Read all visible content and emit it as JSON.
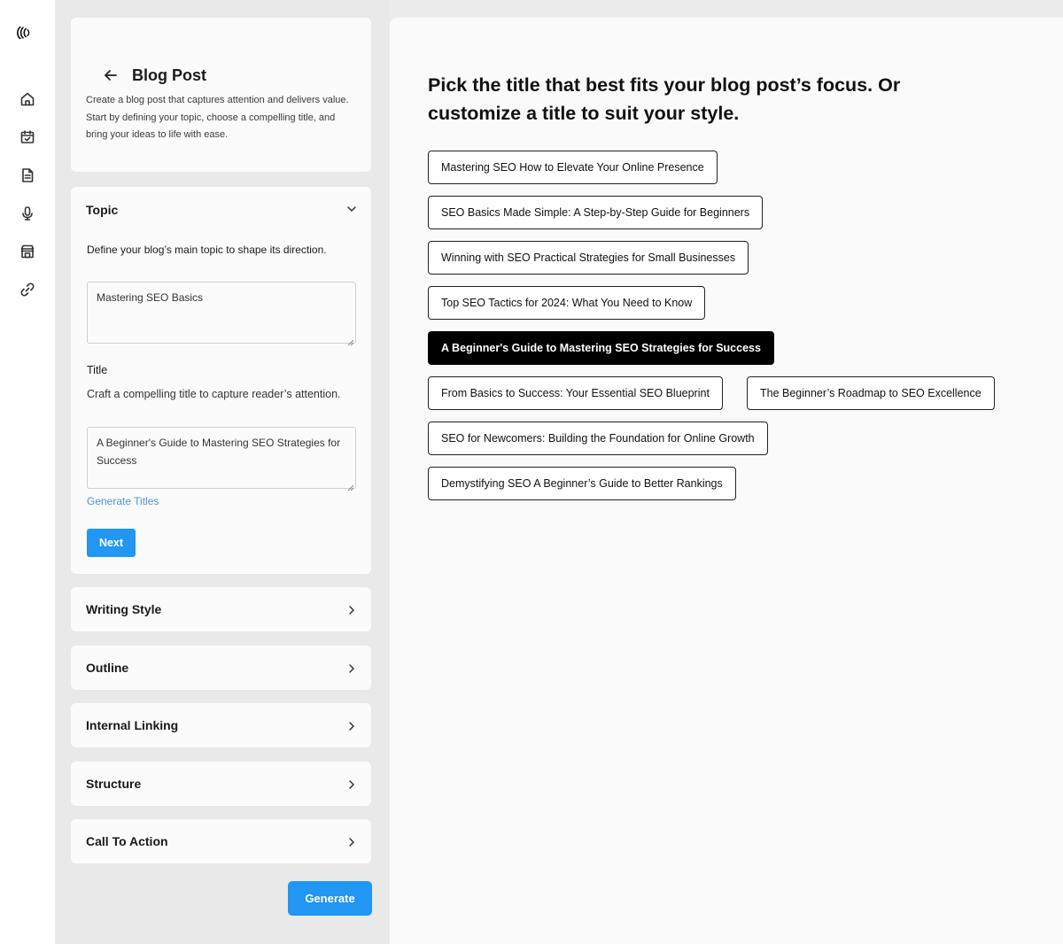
{
  "header": {
    "title": "Blog Post",
    "description": "Create a blog post that captures attention and delivers value. Start by defining your topic, choose a compelling title, and bring your ideas to life with ease."
  },
  "sidebar_icons": [
    "logo-icon",
    "home-icon",
    "calendar-icon",
    "document-icon",
    "microphone-icon",
    "store-icon",
    "link-icon"
  ],
  "topic": {
    "heading": "Topic",
    "label": "Define your blog’s main topic to shape its direction.",
    "value": "Mastering SEO Basics",
    "title_label": "Title",
    "title_sub": "Craft a compelling title to capture reader’s attention.",
    "title_value": "A Beginner's Guide to Mastering SEO Strategies for Success",
    "generate_titles": "Generate Titles",
    "next": "Next"
  },
  "sections": [
    "Writing Style",
    "Outline",
    "Internal Linking",
    "Structure",
    "Call To Action"
  ],
  "generate": "Generate",
  "main": {
    "heading": "Pick the title that best fits your blog post’s focus. Or customize a title to suit your style.",
    "selected_index": 4,
    "titles": [
      "Mastering SEO How to Elevate Your Online Presence",
      "SEO Basics Made Simple: A Step-by-Step Guide for Beginners",
      "Winning with SEO Practical Strategies for Small Businesses",
      "Top SEO Tactics for 2024: What You Need to Know",
      "A Beginner's Guide to Mastering SEO Strategies for Success",
      "From Basics to Success: Your Essential SEO Blueprint",
      "The Beginner’s Roadmap to SEO Excellence",
      "SEO for Newcomers: Building the Foundation for Online Growth",
      "Demystifying SEO A Beginner’s Guide to Better Rankings"
    ]
  },
  "colors": {
    "accent": "#2196f3",
    "link": "#4a97d4",
    "selected_chip": "#000000"
  }
}
